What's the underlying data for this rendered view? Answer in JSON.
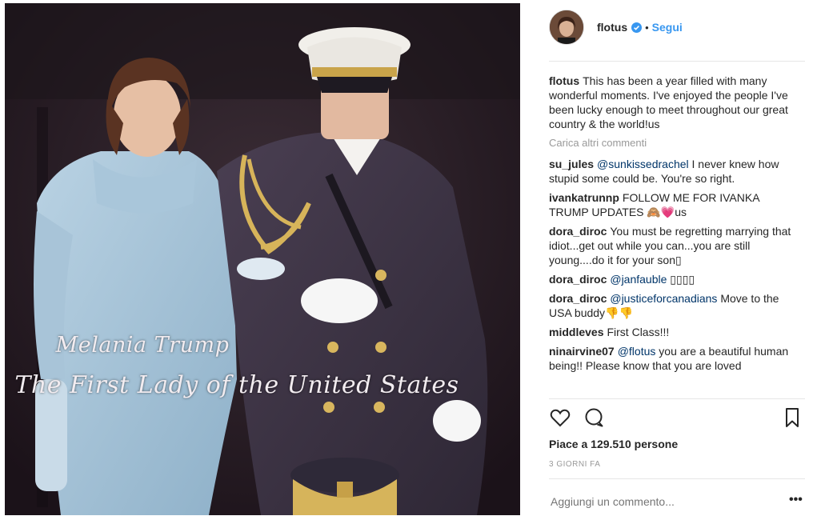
{
  "post": {
    "photo_caption_line1": "Melania Trump",
    "photo_caption_line2": "The First Lady of the United States"
  },
  "header": {
    "username": "flotus",
    "separator": "•",
    "follow_label": "Segui",
    "verified_color": "#3897f0"
  },
  "caption": {
    "username": "flotus",
    "text": "This has been a year filled with many wonderful moments. I've enjoyed the people I've been lucky enough to meet throughout our great country & the world!us"
  },
  "load_more_label": "Carica altri commenti",
  "comments": [
    {
      "user": "su_jules",
      "mention": "@sunkissedrachel",
      "text": "I never knew how stupid some could be. You're so right."
    },
    {
      "user": "ivankatrunnp",
      "mention": "",
      "text": "FOLLOW ME FOR IVANKA TRUMP UPDATES 🙈💗us"
    },
    {
      "user": "dora_diroc",
      "mention": "",
      "text": "You must be regretting marrying that idiot...get out while you can...you are still young....do it for your son▯"
    },
    {
      "user": "dora_diroc",
      "mention": "@janfauble",
      "text": "▯▯▯▯"
    },
    {
      "user": "dora_diroc",
      "mention": "@justiceforcanadians",
      "text": "Move to the USA buddy👎👎"
    },
    {
      "user": "middleves",
      "mention": "",
      "text": "First Class!!!"
    },
    {
      "user": "ninairvine07",
      "mention": "@flotus",
      "text": "you are a beautiful human being!! Please know that you are loved"
    }
  ],
  "actions": {
    "like_icon": "heart-outline-icon",
    "comment_icon": "speech-bubble-icon",
    "save_icon": "bookmark-icon"
  },
  "likes_label": "Piace a 129.510 persone",
  "date_label": "3 GIORNI FA",
  "add_comment_placeholder": "Aggiungi un commento...",
  "more_label": "•••"
}
